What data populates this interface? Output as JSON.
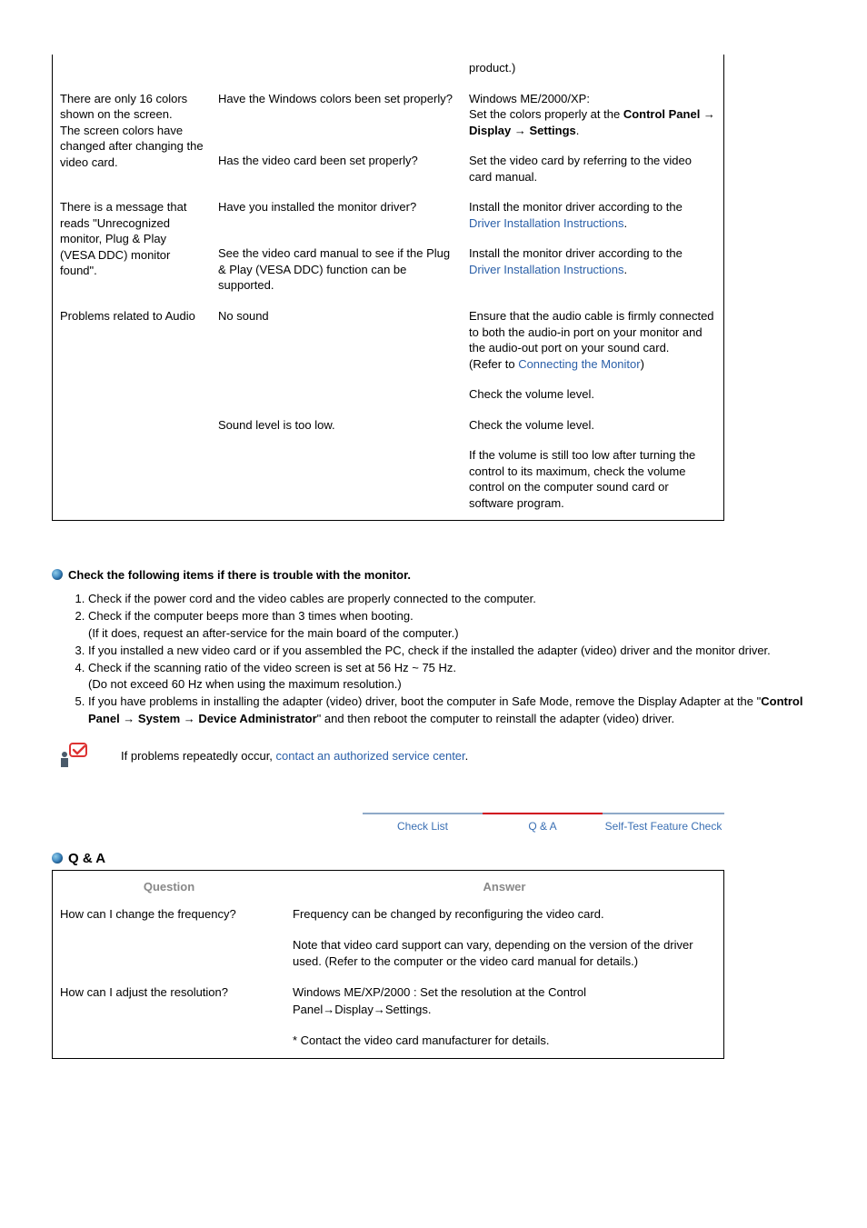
{
  "troubleshoot": {
    "row0": {
      "sol": "product.)"
    },
    "row_colors": {
      "problem": "There are only 16 colors shown on the screen.\nThe screen colors have changed after changing the video card.",
      "check1": "Have the Windows colors been set properly?",
      "sol1_pre": "Windows ME/2000/XP:\nSet the colors properly at the ",
      "sol1_bold": "Control Panel → Display → Settings",
      "sol1_post": ".",
      "check2": "Has the video card been set properly?",
      "sol2": "Set the video card by referring to the video card manual."
    },
    "row_unrec": {
      "problem": "There is a message that reads \"Unrecognized monitor, Plug & Play (VESA DDC) monitor found\".",
      "check1": "Have you installed the monitor driver?",
      "sol_pre": "Install the monitor driver according to the ",
      "sol_link": "Driver Installation Instructions",
      "sol_post": ".",
      "check2": "See the video card manual to see if the Plug & Play (VESA DDC) function can be supported."
    },
    "row_audio": {
      "problem": "Problems related to Audio",
      "check1": "No sound",
      "sol1_line1": "Ensure that the audio cable is firmly connected to both the audio-in port on your monitor and the audio-out port on your sound card.",
      "sol1_refer_pre": "(Refer to ",
      "sol1_refer_link": "Connecting the Monitor",
      "sol1_refer_post": ")",
      "sol2": "Check the volume level.",
      "check2": "Sound level is too low.",
      "sol3": "Check the volume level.",
      "sol4": "If the volume is still too low after turning the control to its maximum, check the volume control on the computer sound card or software program."
    }
  },
  "check_section": {
    "heading": "Check the following items if there is trouble with the monitor.",
    "items": [
      "Check if the power cord and the video cables are properly connected to the computer.",
      "Check if the computer beeps more than 3 times when booting.\n(If it does, request an after-service for the main board of the computer.)",
      "If you installed a new video card or if you assembled the PC, check if the installed the adapter (video) driver and the monitor driver.",
      "Check if the scanning ratio of the video screen is set at 56 Hz ~ 75 Hz.\n(Do not exceed 60 Hz when using the maximum resolution.)",
      "If you have problems in installing the adapter (video) driver, boot the computer in Safe Mode, remove the Display Adapter at the \"Control Panel → System → Device Administrator\" and then reboot the computer to reinstall the adapter (video) driver."
    ],
    "item5_pre": "If you have problems in installing the adapter (video) driver, boot the computer in Safe Mode, remove the Display Adapter at the \"",
    "item5_bold": "Control Panel → System → Device Administrator",
    "item5_post": "\" and then reboot the computer to reinstall the adapter (video) driver.",
    "note_pre": "If problems repeatedly occur, ",
    "note_link": "contact an authorized service center",
    "note_post": "."
  },
  "tabs": {
    "checklist": "Check List",
    "qa": "Q & A",
    "selftest": "Self-Test Feature Check"
  },
  "qa": {
    "title": "Q & A",
    "header_q": "Question",
    "header_a": "Answer",
    "rows": [
      {
        "q": "How can I change the frequency?",
        "a1": "Frequency can be changed by reconfiguring the video card.",
        "a2": "Note that video card support can vary, depending on the version of the driver used. (Refer to the computer or the video card manual for details.)"
      },
      {
        "q": "How can I adjust the resolution?",
        "a1": "Windows ME/XP/2000 : Set the resolution at the Control Panel→Display→Settings.",
        "a2": "* Contact the video card manufacturer for details."
      }
    ]
  }
}
